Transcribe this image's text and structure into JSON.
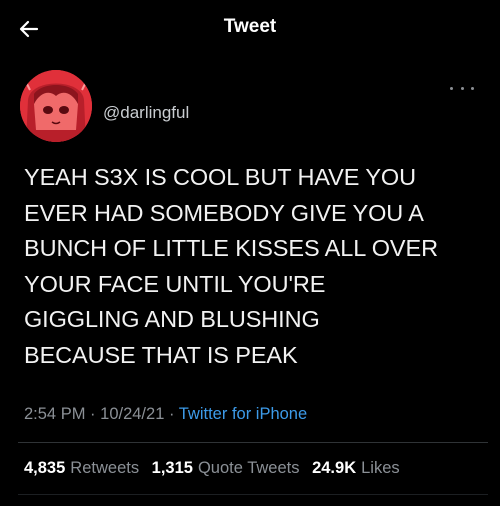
{
  "header": {
    "title": "Tweet",
    "back_icon": "arrow-left-icon"
  },
  "author": {
    "handle": "@darlingful",
    "avatar_icon": "profile-avatar",
    "more_icon": "more-horizontal-icon"
  },
  "tweet": {
    "lines": [
      "YEAH S3X IS COOL BUT HAVE YOU",
      "EVER HAD SOMEBODY GIVE YOU A",
      "BUNCH OF LITTLE KISSES ALL OVER",
      "YOUR FACE UNTIL YOU'RE",
      "GIGGLING AND BLUSHING",
      "BECAUSE THAT IS PEAK"
    ],
    "time": "2:54 PM",
    "date": "10/24/21",
    "separator": "·",
    "source": "Twitter for iPhone"
  },
  "stats": {
    "retweets": {
      "count": "4,835",
      "label": "Retweets"
    },
    "quotes": {
      "count": "1,315",
      "label": "Quote Tweets"
    },
    "likes": {
      "count": "24.9K",
      "label": "Likes"
    }
  },
  "colors": {
    "background": "#000000",
    "link": "#3d9be9",
    "muted": "#8b9096",
    "avatar_bg": "#e0303a"
  }
}
